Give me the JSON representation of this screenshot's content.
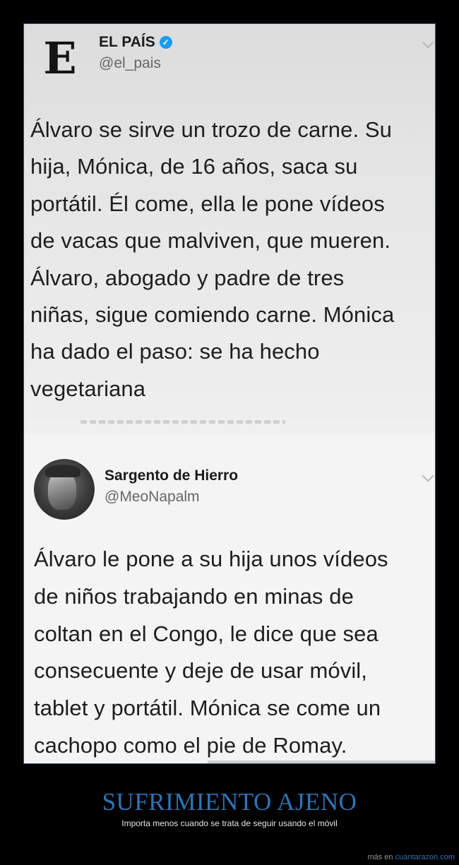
{
  "tweet1": {
    "logo_letter": "E",
    "author_name": "EL PAÍS",
    "verified_icon": "verified-check-icon",
    "handle": "@el_pais",
    "lines": [
      "Álvaro se sirve un trozo de carne. Su",
      "hija, Mónica, de 16 años, saca su",
      "portátil. Él come, ella le pone vídeos",
      "de vacas que malviven, que mueren.",
      "Álvaro, abogado y padre de tres",
      "niñas, sigue comiendo carne. Mónica",
      "ha dado el paso: se ha hecho",
      "vegetariana"
    ]
  },
  "tweet2": {
    "author_name": "Sargento de Hierro",
    "handle": "@MeoNapalm",
    "lines": [
      "Álvaro le pone a su hija unos vídeos",
      "de niños trabajando en minas de",
      "coltan en el Congo, le dice que sea",
      "consecuente y deje de usar móvil,",
      "tablet y portátil. Mónica se come un",
      "cachopo como el pie de Romay."
    ]
  },
  "caption": {
    "title": "SUFRIMIENTO AJENO",
    "subtitle": "Importa menos cuando se trata de seguir usando el móvil"
  },
  "footer": {
    "prefix": "más en ",
    "link": "cuantarazon.com"
  },
  "colors": {
    "accent": "#2f74b5",
    "verified": "#1d9bf0",
    "background": "#000000"
  }
}
